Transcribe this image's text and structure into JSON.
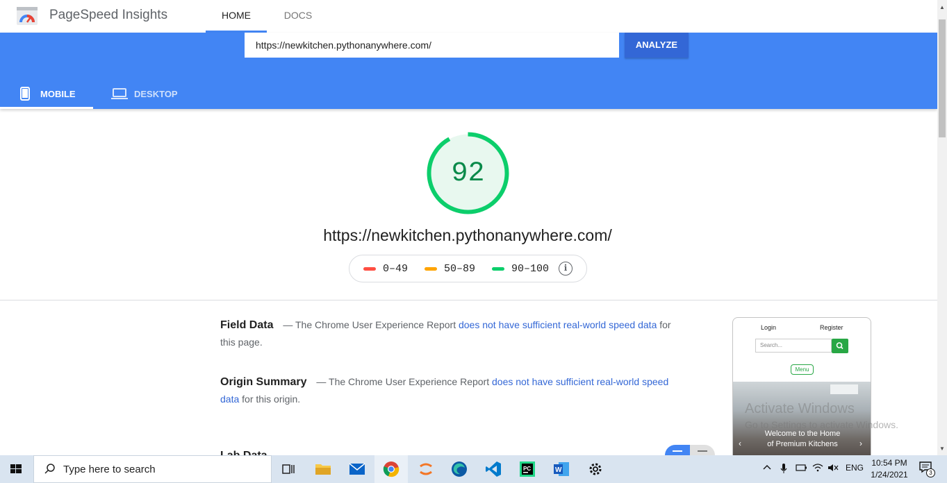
{
  "app": {
    "title": "PageSpeed Insights"
  },
  "nav": {
    "home": "HOME",
    "docs": "DOCS"
  },
  "search": {
    "value": "https://newkitchen.pythonanywhere.com/",
    "analyze_label": "ANALYZE"
  },
  "device_tabs": [
    {
      "label": "MOBILE",
      "active": true
    },
    {
      "label": "DESKTOP",
      "active": false
    }
  ],
  "score": {
    "value": "92",
    "fraction": 0.92,
    "color": "#0cce6b"
  },
  "page_url": "https://newkitchen.pythonanywhere.com/",
  "legend": [
    {
      "range": "0–49",
      "color": "#ff4e42"
    },
    {
      "range": "50–89",
      "color": "#ffa400"
    },
    {
      "range": "90–100",
      "color": "#0cce6b"
    }
  ],
  "field_data": {
    "title": "Field Data",
    "prefix": "— The Chrome User Experience Report",
    "link": "does not have sufficient real-world speed data",
    "suffix": "for this page."
  },
  "origin_summary": {
    "title": "Origin Summary",
    "prefix": "— The Chrome User Experience Report",
    "link": "does not have sufficient real-world speed data",
    "suffix": "for this origin."
  },
  "lab_data": {
    "title": "Lab Data"
  },
  "thumbnail": {
    "login": "Login",
    "register": "Register",
    "search_placeholder": "Search...",
    "menu": "Menu",
    "hero_line1": "Welcome to the Home",
    "hero_line2": "of Premium Kitchens"
  },
  "watermark": {
    "line1": "Activate Windows",
    "line2": "Go to Settings to activate Windows."
  },
  "taskbar": {
    "search_placeholder": "Type here to search",
    "language": "ENG",
    "time": "10:54 PM",
    "date": "1/24/2021",
    "notification_count": "3"
  }
}
